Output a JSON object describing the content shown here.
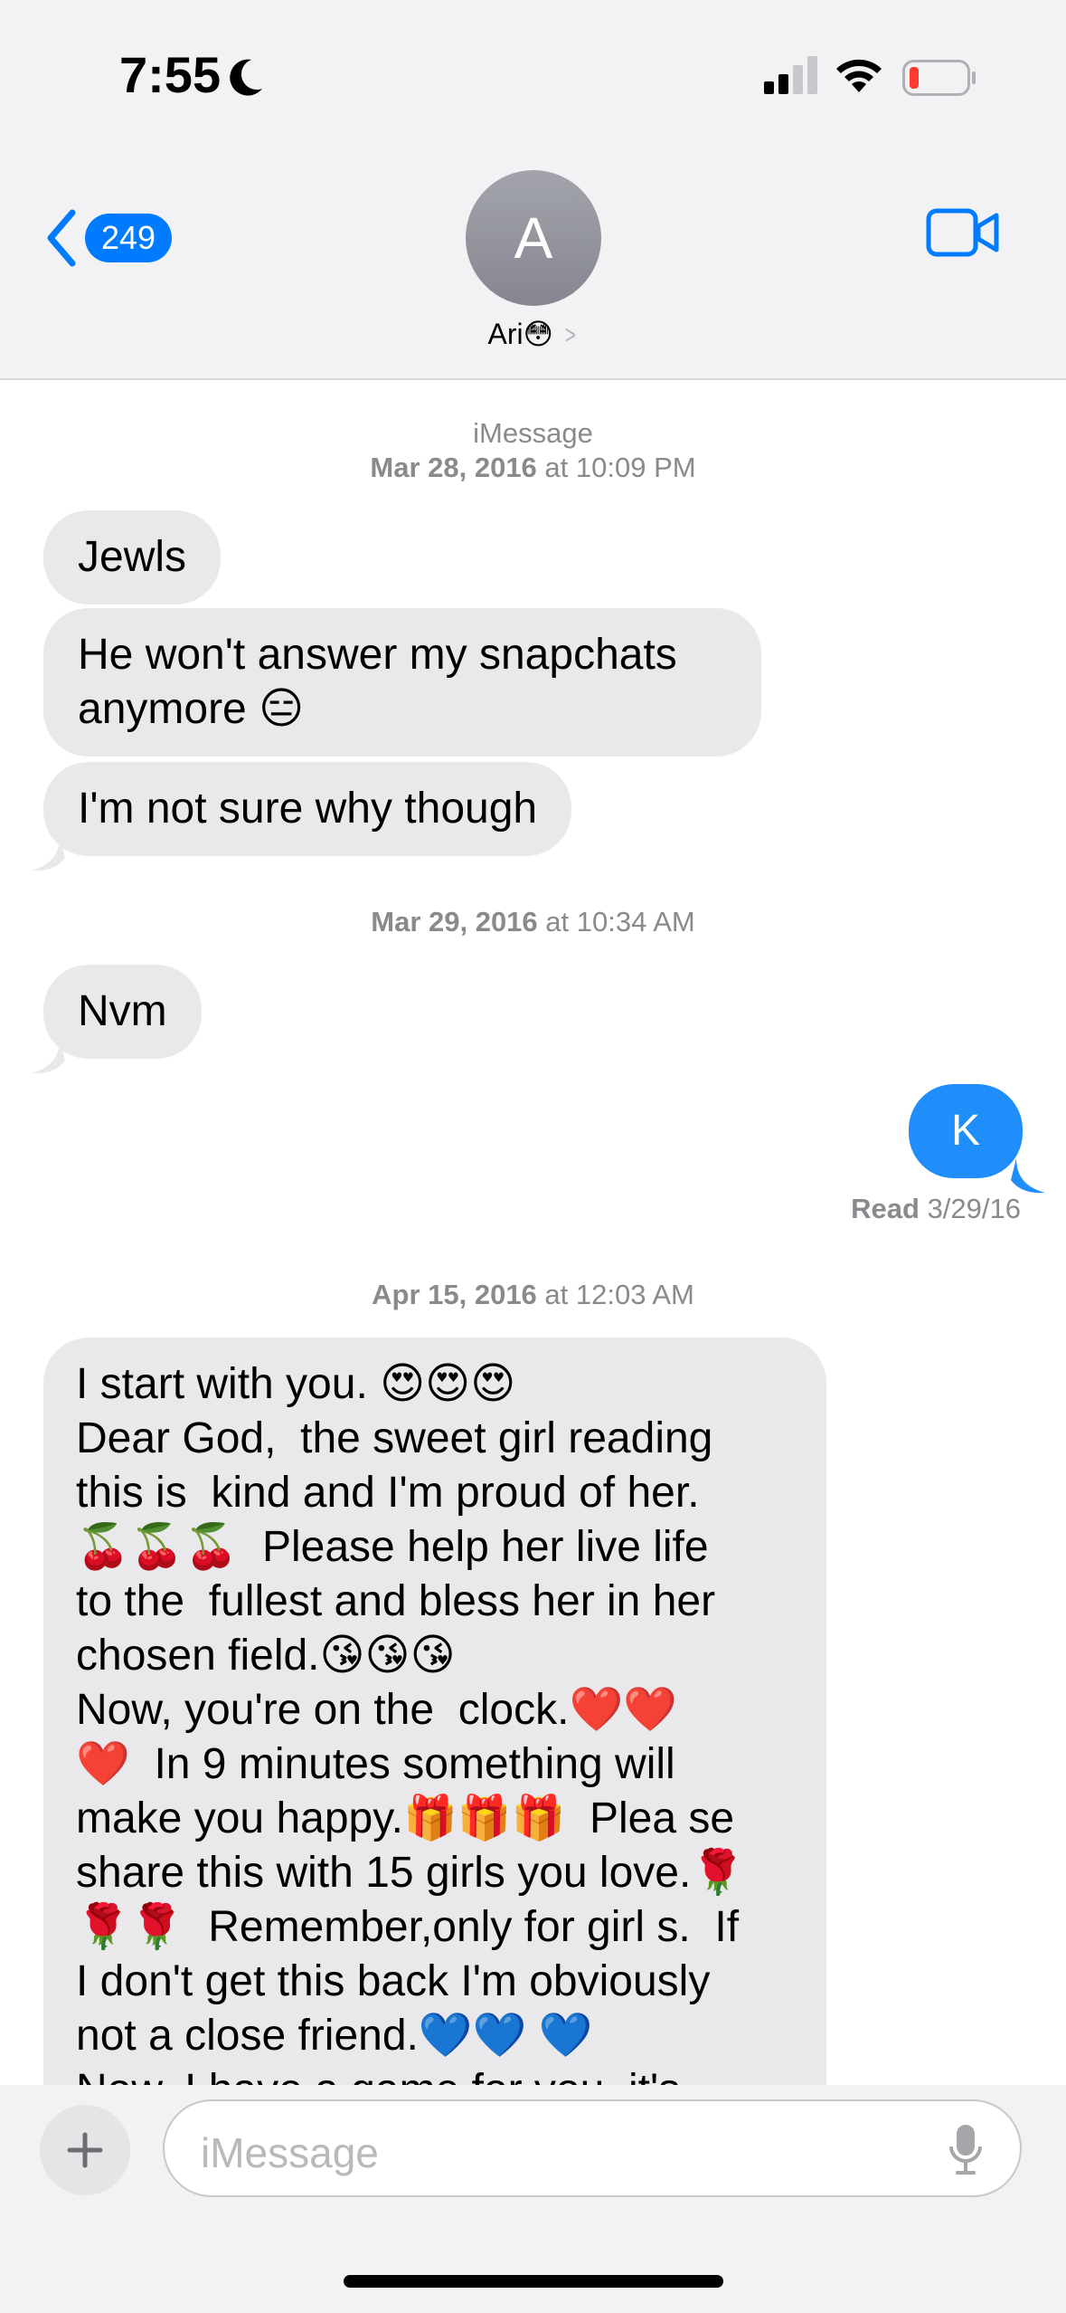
{
  "status_bar": {
    "time": "7:55",
    "icons": [
      "moon-icon",
      "signal-icon",
      "wifi-icon",
      "battery-low-icon"
    ]
  },
  "header": {
    "back_count": "249",
    "avatar_initial": "A",
    "contact_name": "Ari😳",
    "chevron": ">",
    "accent_color": "#007aff"
  },
  "messages": {
    "service_label": "iMessage",
    "ts1_date": "Mar 28, 2016",
    "ts1_at": " at 10:09 PM",
    "msg1": "Jewls",
    "msg2_line1": "He won't answer my snapchats",
    "msg2_line2": "anymore 😑",
    "msg3": "I'm not sure why though",
    "ts2_date": "Mar 29, 2016",
    "ts2_at": " at 10:34 AM",
    "msg4": "Nvm",
    "msg5_outgoing": "K",
    "read_label": "Read",
    "read_date": " 3/29/16",
    "ts3_date": "Apr 15, 2016",
    "ts3_at": " at 12:03 AM",
    "long_lines": [
      "I start with you. 😍😍😍",
      "Dear God,  the sweet girl reading",
      "this is  kind and I'm proud of her.",
      "🍒🍒🍒  Please help her live life",
      "to the  fullest and bless her in her",
      "chosen field.😘😘😘",
      "Now, you're on the  clock.❤️❤️",
      "❤️  In 9 minutes something will",
      "make you happy.🎁🎁🎁  Plea se",
      "share this with 15 girls you love.🌹",
      "🌹🌹  Remember,only for girl s.  If",
      "I don't get this back I'm obviously",
      "not a close friend.💙💙 💙",
      "Now, I have a game for you, it's"
    ]
  },
  "input": {
    "placeholder": "iMessage"
  },
  "colors": {
    "incoming_bubble": "#e9e9eb",
    "outgoing_bubble": "#1f8efb"
  }
}
